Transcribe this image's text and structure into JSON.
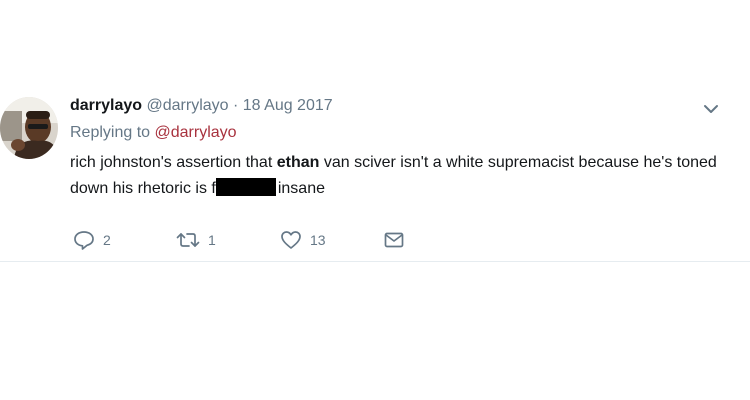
{
  "tweet": {
    "display_name": "darrylayo",
    "handle": "@darrylayo",
    "separator": "·",
    "date": "18 Aug 2017",
    "reply_prefix": "Replying to",
    "reply_to": "@darrylayo",
    "text_part1": "rich johnston's assertion that ",
    "text_bold": "ethan",
    "text_part2": " van sciver isn't a white supremacist because he's toned down his rhetoric is f",
    "text_part3": "insane",
    "avatar_icon": "user-avatar-photo",
    "caret_icon": "chevron-down-icon"
  },
  "actions": {
    "reply_count": "2",
    "retweet_count": "1",
    "like_count": "13",
    "reply_icon": "reply-icon",
    "retweet_icon": "retweet-icon",
    "like_icon": "heart-icon",
    "dm_icon": "envelope-icon"
  },
  "colors": {
    "secondary_text": "#657786",
    "reply_link": "#a8323e",
    "divider": "#e6ecf0"
  }
}
